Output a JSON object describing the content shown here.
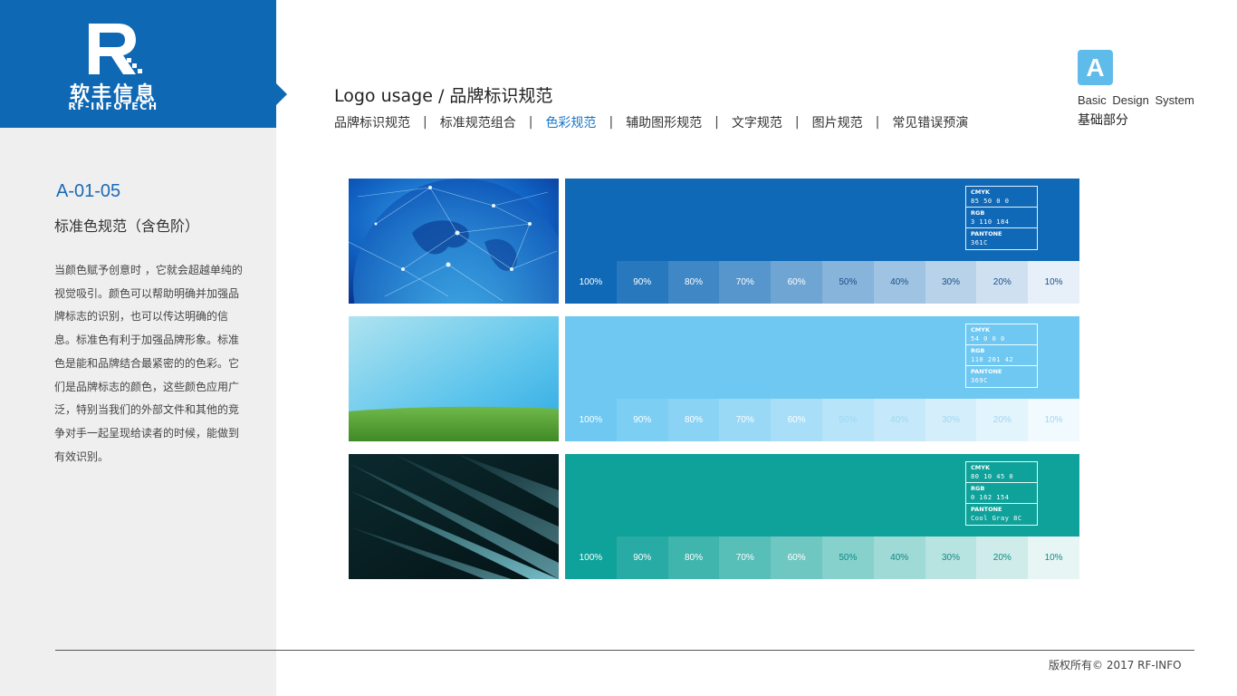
{
  "brand": {
    "logo_letter": "R",
    "name_cn": "软丰信息",
    "name_en": "RF-INFOTECH"
  },
  "sidebar": {
    "code": "A-01-05",
    "subtitle": "标准色规范（含色阶）",
    "description": "当颜色赋予创意时 ，它就会超越单纯的视觉吸引。颜色可以帮助明确并加强品牌标志的识别，也可以传达明确的信息。标准色有利于加强品牌形象。标准色是能和品牌结合最紧密的的色彩。它们是品牌标志的颜色，这些颜色应用广泛，特别当我们的外部文件和其他的竞争对手一起呈现给读者的时候，能做到有效识别。"
  },
  "header": {
    "title": "Logo usage  /  品牌标识规范",
    "nav": [
      {
        "label": "品牌标识规范",
        "active": false
      },
      {
        "label": "标准规范组合",
        "active": false
      },
      {
        "label": "色彩规范",
        "active": true
      },
      {
        "label": "辅助图形规范",
        "active": false
      },
      {
        "label": "文字规范",
        "active": false
      },
      {
        "label": "图片规范",
        "active": false
      },
      {
        "label": "常见错误预演",
        "active": false
      }
    ],
    "separator": "|"
  },
  "system": {
    "badge": "A",
    "name_en": "Basic  Design  System",
    "name_cn": "基础部分"
  },
  "colors": [
    {
      "name": "blue",
      "hex": "#0f69b6",
      "rgb": [
        15,
        105,
        182
      ],
      "photo": "globe",
      "cmyk_label": "CMYK",
      "cmyk": "85  50 0 0",
      "rgb_label": "RGB",
      "rgb_value": "3 110 184",
      "pantone_label": "PANTONE",
      "pantone": "361C",
      "text_dark": "#1a4f8a",
      "tints": [
        "100%",
        "90%",
        "80%",
        "70%",
        "60%",
        "50%",
        "40%",
        "30%",
        "20%",
        "10%"
      ]
    },
    {
      "name": "sky",
      "hex": "#6ec8f2",
      "rgb": [
        110,
        200,
        242
      ],
      "photo": "sky",
      "cmyk_label": "CMYK",
      "cmyk": "54  0  0  0",
      "rgb_label": "RGB",
      "rgb_value": "110  201  42",
      "pantone_label": "PANTONE",
      "pantone": "369C",
      "text_dark": "#ffffff",
      "tints": [
        "100%",
        "90%",
        "80%",
        "70%",
        "60%",
        "50%",
        "40%",
        "30%",
        "20%",
        "10%"
      ]
    },
    {
      "name": "teal",
      "hex": "#0fa29a",
      "rgb": [
        15,
        162,
        154
      ],
      "photo": "laser",
      "cmyk_label": "CMYK",
      "cmyk": "80  10  45  0",
      "rgb_label": "RGB",
      "rgb_value": "0 162 154",
      "pantone_label": "PANTONE",
      "pantone": "Cool Gray 8C",
      "text_dark": "#0f8a83",
      "tints": [
        "100%",
        "90%",
        "80%",
        "70%",
        "60%",
        "50%",
        "40%",
        "30%",
        "20%",
        "10%"
      ]
    }
  ],
  "footer": {
    "copyright": "版权所有©   2017   RF-INFO"
  }
}
